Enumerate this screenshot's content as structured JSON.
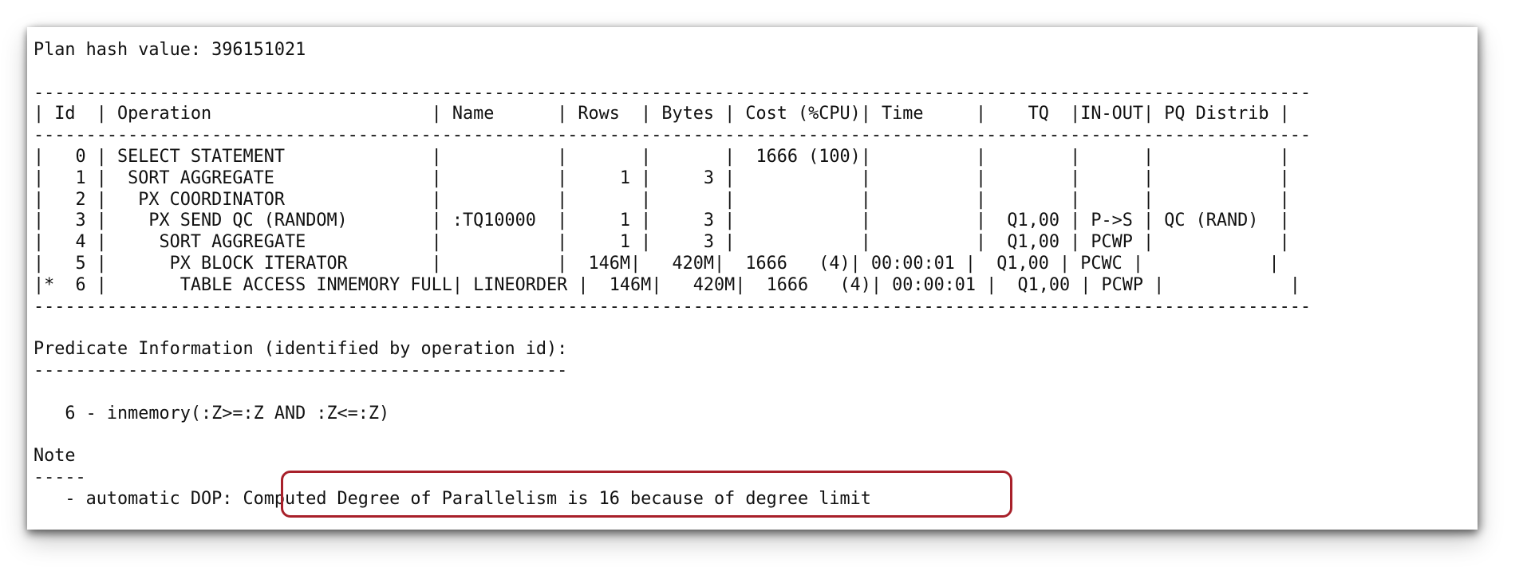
{
  "plan_output": {
    "lines": [
      "Plan hash value: 396151021",
      "",
      "--------------------------------------------------------------------------------------------------------------------------",
      "| Id  | Operation                     | Name      | Rows  | Bytes | Cost (%CPU)| Time     |    TQ  |IN-OUT| PQ Distrib |",
      "--------------------------------------------------------------------------------------------------------------------------",
      "|   0 | SELECT STATEMENT              |           |       |       |  1666 (100)|          |        |      |            |",
      "|   1 |  SORT AGGREGATE               |           |     1 |     3 |            |          |        |      |            |",
      "|   2 |   PX COORDINATOR              |           |       |       |            |          |        |      |            |",
      "|   3 |    PX SEND QC (RANDOM)        | :TQ10000  |     1 |     3 |            |          |  Q1,00 | P->S | QC (RAND)  |",
      "|   4 |     SORT AGGREGATE            |           |     1 |     3 |            |          |  Q1,00 | PCWP |            |",
      "|   5 |      PX BLOCK ITERATOR        |           |  146M|   420M|  1666   (4)| 00:00:01 |  Q1,00 | PCWC |            |",
      "|*  6 |       TABLE ACCESS INMEMORY FULL| LINEORDER |  146M|   420M|  1666   (4)| 00:00:01 |  Q1,00 | PCWP |            |",
      "--------------------------------------------------------------------------------------------------------------------------",
      "",
      "Predicate Information (identified by operation id):",
      "---------------------------------------------------",
      "",
      "   6 - inmemory(:Z>=:Z AND :Z<=:Z)",
      "",
      "Note",
      "-----",
      "   - automatic DOP: Computed Degree of Parallelism is 16 because of degree limit"
    ]
  }
}
